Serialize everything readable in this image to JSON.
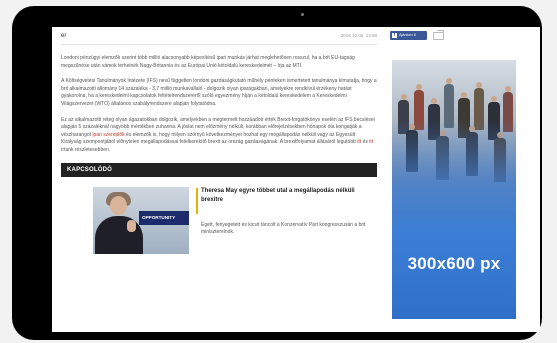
{
  "article": {
    "author": "er",
    "date": "2018.10.05. 13:58",
    "p1": "Londoni pénzügyi elemzők szerint több millió alacsonyabb képesítésű ipari munkás járhat meglehetősen rosszul, ha a brit EU-tagság megszűnése után vámok terhelnék Nagy-Britannia és az Európai Unió kétoldalú kereskedelmét – írja az MTI.",
    "p2": "A Költségvetési Tanulmányok Intézete (IFS) nevű független londoni gazdaságkutató műhely pénteken ismertetett tanulmánya kimutatja, hogy a brit alkalmazotti állomány 14 százaléka - 3,7 millió munkavállaló - dolgozik olyan iparágakban, amelyekre rendkívül érzékeny hatást gyakorolna, ha a kereskedelmi kapcsolatok feltételrendszeréről szóló egyezmény híján a kétoldalú kereskedelem a Kereskedelmi Világszervezet (WTO) általános szabályrendszere alapján folytatódna.",
    "p3_a": "Ez az alkalmazotti réteg olyan ágazatokban dolgozik, amelyekben a megtermelt hozzáadott érték Brexit-forgatókönyv esetén az IFS becslései alapján 5 százaléknál nagyobb mértékben zuhanna. A jóslat nem előzmény nélküli, korábban előrejelzésekben hónapok óta kongatják a vészharangot ",
    "p3_link1": "ipari szereplők",
    "p3_b": " és elemzők is, hogy milyen szörnyű következményei hozhat egy megállapodás nélküli vagy az Egyesült Királyság szempontjából előnytelen megállapodással felelkerekítő brexit az ország gazdaságának. A brexitfolyamat állásáról legutóbb ",
    "p3_link2": "itt",
    "p3_c": " és ",
    "p3_link3": "itt",
    "p3_d": " írtunk részletesebben."
  },
  "related": {
    "heading": "KAPCSOLÓDÓ",
    "thumb_banner": "OPPORTUNITY",
    "title": "Theresa May egyre többet utal a megállapodás nélküli brexitre",
    "lead": "Égett, fenyegetett és kicsit táncolt a Konzervatív Párt kongresszusán a brit miniszterelnök."
  },
  "share": {
    "facebook_label": "Ajánlom 6",
    "icons": [
      "facebook-icon",
      "share-icon"
    ]
  },
  "ad": {
    "label": "300x600 px"
  },
  "colors": {
    "link": "#c0392b",
    "facebook": "#3b5998",
    "related_bar": "#222222",
    "ad_blue": "#3d7fd6",
    "accent": "#e0b400"
  }
}
